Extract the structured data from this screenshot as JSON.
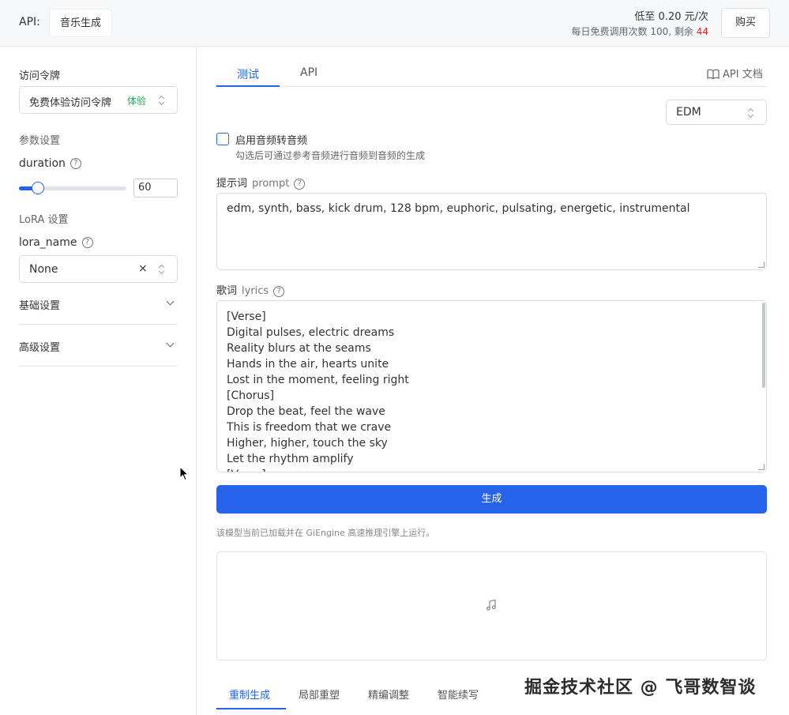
{
  "header": {
    "api_label": "API:",
    "api_name": "音乐生成",
    "price": "低至 0.20 元/次",
    "quota_prefix": "每日免费调用次数 100, 剩余 ",
    "quota_remaining": "44",
    "buy_label": "购买"
  },
  "sidebar": {
    "token_label": "访问令牌",
    "token_value": "免费体验访问令牌",
    "token_tag": "体验",
    "params_label": "参数设置",
    "duration_label": "duration",
    "duration_value": "60",
    "duration_fraction": 0.18,
    "lora_section": "LoRA 设置",
    "lora_name_label": "lora_name",
    "lora_name_value": "None",
    "clear_symbol": "×",
    "help_symbol": "?",
    "basic_settings": "基础设置",
    "advanced_settings": "高级设置"
  },
  "main": {
    "tabs": [
      {
        "label": "测试"
      },
      {
        "label": "API"
      }
    ],
    "doc_link": "API 文档",
    "style_select": "EDM",
    "audio2audio_label": "启用音频转音频",
    "audio2audio_hint": "勾选后可通过参考音频进行音频到音频的生成",
    "prompt_label": "提示词",
    "prompt_label_en": "prompt",
    "prompt_value": "edm, synth, bass, kick drum, 128 bpm, euphoric, pulsating, energetic, instrumental",
    "lyrics_label": "歌词",
    "lyrics_label_en": "lyrics",
    "lyrics_lines": [
      "[Verse]",
      "Digital pulses, electric dreams",
      "Reality blurs at the seams",
      "Hands in the air, hearts unite",
      "Lost in the moment, feeling right",
      "[Chorus]",
      "Drop the beat, feel the wave",
      "This is freedom that we crave",
      "Higher, higher, touch the sky",
      "Let the rhythm amplify",
      "[Verse]"
    ],
    "generate_label": "生成",
    "engine_note": "该模型当前已加载并在 GiEngine 高速推理引擎上运行。",
    "bottom_tabs": [
      {
        "label": "重制生成"
      },
      {
        "label": "局部重塑"
      },
      {
        "label": "精编调整"
      },
      {
        "label": "智能续写"
      }
    ]
  },
  "watermark": "掘金技术社区 @ 飞哥数智谈",
  "colors": {
    "accent": "#2563eb",
    "success": "#1dae52",
    "danger": "#e02424"
  }
}
